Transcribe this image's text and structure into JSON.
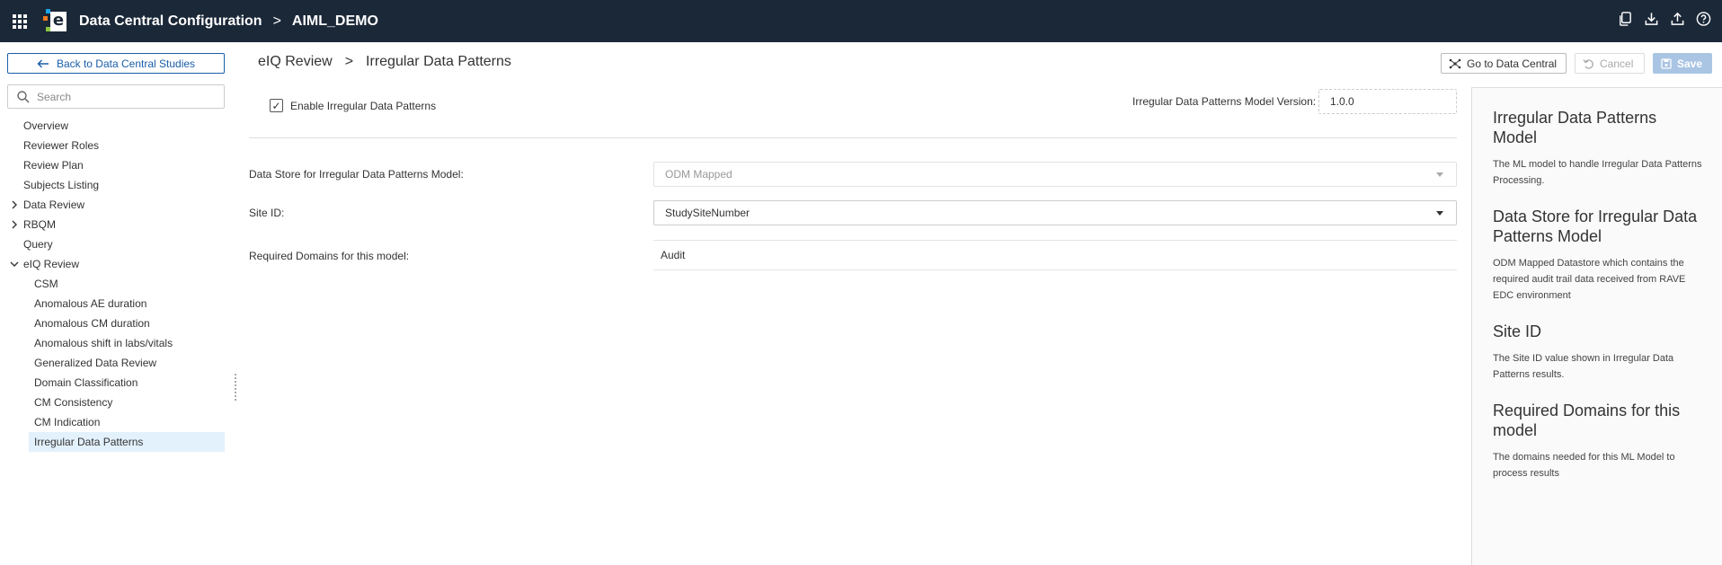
{
  "header": {
    "app_title": "Data Central Configuration",
    "breadcrumb_sep": ">",
    "study": "AIML_DEMO",
    "icons": [
      "copy-icon",
      "download-icon",
      "upload-icon",
      "help-icon"
    ]
  },
  "sidebar": {
    "back_label": "Back to Data Central Studies",
    "search_placeholder": "Search",
    "items": [
      {
        "label": "Overview"
      },
      {
        "label": "Reviewer Roles"
      },
      {
        "label": "Review Plan"
      },
      {
        "label": "Subjects Listing"
      },
      {
        "label": "Data Review",
        "caret": "›"
      },
      {
        "label": "RBQM",
        "caret": "›"
      },
      {
        "label": "Query"
      },
      {
        "label": "eIQ Review",
        "caret": "⌄"
      },
      {
        "label": "CSM"
      },
      {
        "label": "Anomalous AE duration"
      },
      {
        "label": "Anomalous CM duration"
      },
      {
        "label": "Anomalous shift in labs/vitals"
      },
      {
        "label": "Generalized Data Review"
      },
      {
        "label": "Domain Classification"
      },
      {
        "label": "CM Consistency"
      },
      {
        "label": "CM Indication"
      },
      {
        "label": "Irregular Data Patterns",
        "selected": true
      }
    ]
  },
  "main": {
    "breadcrumb_parent": "eIQ Review",
    "breadcrumb_sep": ">",
    "breadcrumb_current": "Irregular Data Patterns",
    "goto_label": "Go to Data Central",
    "cancel_label": "Cancel",
    "save_label": "Save",
    "enable_label": "Enable Irregular Data Patterns",
    "enable_checked": true,
    "check_mark": "✓",
    "version_label": "Irregular Data Patterns Model Version:",
    "version_value": "1.0.0",
    "data_store_label": "Data Store for Irregular Data Patterns Model:",
    "data_store_value": "ODM Mapped",
    "site_id_label": "Site ID:",
    "site_id_value": "StudySiteNumber",
    "required_domains_label": "Required Domains for this model:",
    "required_domains_value": "Audit"
  },
  "help": {
    "sections": [
      {
        "title": "Irregular Data Patterns Model",
        "text": "The ML model to handle Irregular Data Patterns Processing."
      },
      {
        "title": "Data Store for Irregular Data Patterns Model",
        "text": "ODM Mapped Datastore which contains the required audit trail data received from RAVE EDC environment"
      },
      {
        "title": "Site ID",
        "text": "The Site ID value shown in Irregular Data Patterns results."
      },
      {
        "title": "Required Domains for this model",
        "text": "The domains needed for this ML Model to process results"
      }
    ]
  },
  "colors": {
    "topbar": "#1b2838",
    "link_blue": "#1a5ea8",
    "selected_bg": "#e3f1fc",
    "save_disabled": "#a9c5e3"
  }
}
